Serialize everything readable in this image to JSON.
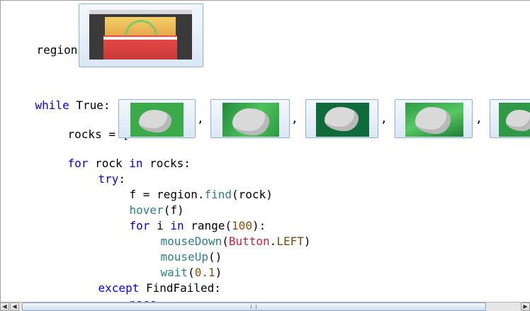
{
  "code": {
    "region_prefix": "region = ",
    "while_kw": "while",
    "while_rest": " True:",
    "rocks_prefix": "rocks = [",
    "comma": ",",
    "for_kw": "for",
    "for_var": " rock ",
    "in_kw": "in",
    "for_rest": " rocks:",
    "try_kw": "try",
    "try_colon": ":",
    "find_prefix": "f = region.",
    "find_fn": "find",
    "find_rest": "(rock)",
    "hover_fn": "hover",
    "hover_rest": "(f)",
    "for2_kw": "for",
    "for2_var": " i ",
    "in2_kw": "in",
    "range_text": " range(",
    "range_num": "100",
    "range_close": "):",
    "mousedown_fn": "mouseDown",
    "paren_open": "(",
    "button_cls": "Button",
    "dot": ".",
    "left_const": "LEFT",
    "paren_close": ")",
    "mouseup_fn": "mouseUp",
    "mouseup_rest": "()",
    "wait_fn": "wait",
    "wait_open": "(",
    "wait_num": "0.1",
    "wait_close": ")",
    "except_kw": "except",
    "except_rest": " FindFailed:",
    "pass_kw": "pass"
  },
  "colors": {
    "keyword": "#0000ee",
    "function": "#2e7f86",
    "class": "#cc1f3a",
    "constant": "#7b4a0f",
    "number": "#8a4b0b"
  },
  "icons": {
    "region": "region-screenshot-thumbnail",
    "rock": "rock-image-thumbnail"
  },
  "scrollbar": {
    "left_arrow": "◀",
    "right_arrow": "▶"
  }
}
